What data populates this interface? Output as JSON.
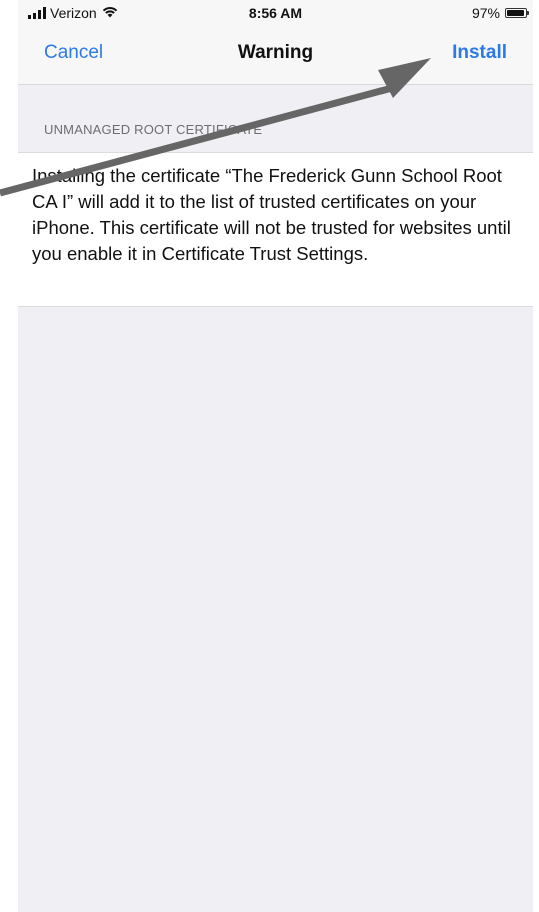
{
  "status_bar": {
    "carrier": "Verizon",
    "time": "8:56 AM",
    "battery": "97%",
    "battery_level": 0.97
  },
  "nav": {
    "cancel_label": "Cancel",
    "title": "Warning",
    "install_label": "Install"
  },
  "section": {
    "header": "UNMANAGED ROOT CERTIFICATE",
    "body": "Installing the certificate “The Frederick Gunn School Root CA I” will add it to the list of trusted certificates on your iPhone. This certificate will not be trusted for websites until you enable it in Certificate Trust Settings."
  },
  "icons": {
    "signal": "signal-bars-icon",
    "wifi": "wifi-icon",
    "battery": "battery-icon",
    "annotation": "annotation-arrow"
  },
  "colors": {
    "accent": "#2c7be5",
    "background": "#efeff4",
    "annotation": "#666666"
  }
}
